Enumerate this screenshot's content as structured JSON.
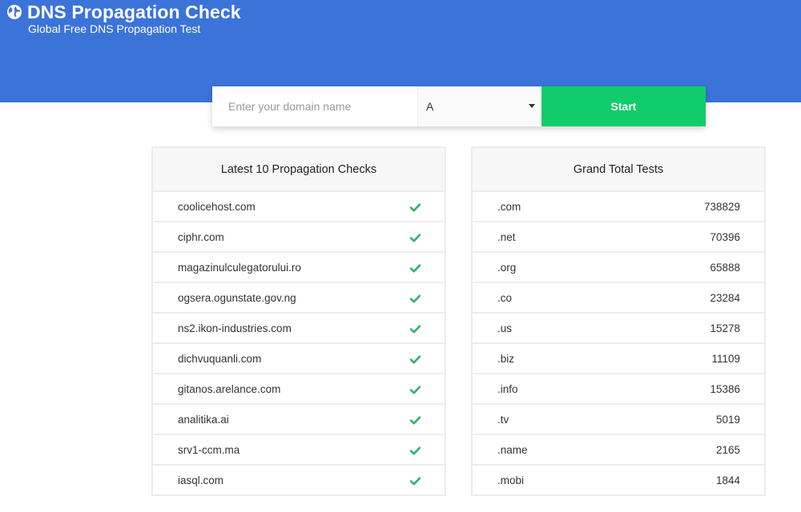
{
  "header": {
    "title": "DNS Propagation Check",
    "subtitle": "Global Free DNS Propagation Test",
    "background_color": "#3b73d9",
    "logo_icon": "globe-icon"
  },
  "search": {
    "placeholder": "Enter your domain name",
    "value": "",
    "record_type": "A",
    "start_label": "Start",
    "start_color": "#10cc6a"
  },
  "latest": {
    "title": "Latest 10 Propagation Checks",
    "status_icon": "check-icon",
    "status_color": "#2fb36a",
    "items": [
      {
        "domain": "coolicehost.com"
      },
      {
        "domain": "ciphr.com"
      },
      {
        "domain": "magazinulculegatorului.ro"
      },
      {
        "domain": "ogsera.ogunstate.gov.ng"
      },
      {
        "domain": "ns2.ikon-industries.com"
      },
      {
        "domain": "dichvuquanli.com"
      },
      {
        "domain": "gitanos.arelance.com"
      },
      {
        "domain": "analitika.ai"
      },
      {
        "domain": "srv1-ccm.ma"
      },
      {
        "domain": "iasql.com"
      }
    ]
  },
  "totals": {
    "title": "Grand Total Tests",
    "items": [
      {
        "tld": ".com",
        "count": "738829"
      },
      {
        "tld": ".net",
        "count": "70396"
      },
      {
        "tld": ".org",
        "count": "65888"
      },
      {
        "tld": ".co",
        "count": "23284"
      },
      {
        "tld": ".us",
        "count": "15278"
      },
      {
        "tld": ".biz",
        "count": "11109"
      },
      {
        "tld": ".info",
        "count": "15386"
      },
      {
        "tld": ".tv",
        "count": "5019"
      },
      {
        "tld": ".name",
        "count": "2165"
      },
      {
        "tld": ".mobi",
        "count": "1844"
      }
    ]
  }
}
